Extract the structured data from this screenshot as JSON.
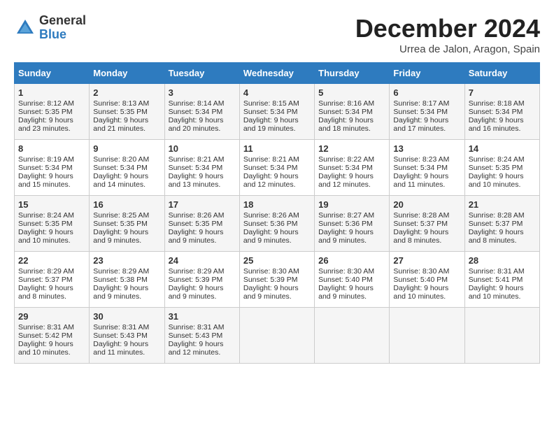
{
  "logo": {
    "general": "General",
    "blue": "Blue"
  },
  "title": "December 2024",
  "location": "Urrea de Jalon, Aragon, Spain",
  "days_of_week": [
    "Sunday",
    "Monday",
    "Tuesday",
    "Wednesday",
    "Thursday",
    "Friday",
    "Saturday"
  ],
  "weeks": [
    [
      {
        "day": "1",
        "sunrise": "Sunrise: 8:12 AM",
        "sunset": "Sunset: 5:35 PM",
        "daylight": "Daylight: 9 hours and 23 minutes."
      },
      {
        "day": "2",
        "sunrise": "Sunrise: 8:13 AM",
        "sunset": "Sunset: 5:35 PM",
        "daylight": "Daylight: 9 hours and 21 minutes."
      },
      {
        "day": "3",
        "sunrise": "Sunrise: 8:14 AM",
        "sunset": "Sunset: 5:34 PM",
        "daylight": "Daylight: 9 hours and 20 minutes."
      },
      {
        "day": "4",
        "sunrise": "Sunrise: 8:15 AM",
        "sunset": "Sunset: 5:34 PM",
        "daylight": "Daylight: 9 hours and 19 minutes."
      },
      {
        "day": "5",
        "sunrise": "Sunrise: 8:16 AM",
        "sunset": "Sunset: 5:34 PM",
        "daylight": "Daylight: 9 hours and 18 minutes."
      },
      {
        "day": "6",
        "sunrise": "Sunrise: 8:17 AM",
        "sunset": "Sunset: 5:34 PM",
        "daylight": "Daylight: 9 hours and 17 minutes."
      },
      {
        "day": "7",
        "sunrise": "Sunrise: 8:18 AM",
        "sunset": "Sunset: 5:34 PM",
        "daylight": "Daylight: 9 hours and 16 minutes."
      }
    ],
    [
      {
        "day": "8",
        "sunrise": "Sunrise: 8:19 AM",
        "sunset": "Sunset: 5:34 PM",
        "daylight": "Daylight: 9 hours and 15 minutes."
      },
      {
        "day": "9",
        "sunrise": "Sunrise: 8:20 AM",
        "sunset": "Sunset: 5:34 PM",
        "daylight": "Daylight: 9 hours and 14 minutes."
      },
      {
        "day": "10",
        "sunrise": "Sunrise: 8:21 AM",
        "sunset": "Sunset: 5:34 PM",
        "daylight": "Daylight: 9 hours and 13 minutes."
      },
      {
        "day": "11",
        "sunrise": "Sunrise: 8:21 AM",
        "sunset": "Sunset: 5:34 PM",
        "daylight": "Daylight: 9 hours and 12 minutes."
      },
      {
        "day": "12",
        "sunrise": "Sunrise: 8:22 AM",
        "sunset": "Sunset: 5:34 PM",
        "daylight": "Daylight: 9 hours and 12 minutes."
      },
      {
        "day": "13",
        "sunrise": "Sunrise: 8:23 AM",
        "sunset": "Sunset: 5:34 PM",
        "daylight": "Daylight: 9 hours and 11 minutes."
      },
      {
        "day": "14",
        "sunrise": "Sunrise: 8:24 AM",
        "sunset": "Sunset: 5:35 PM",
        "daylight": "Daylight: 9 hours and 10 minutes."
      }
    ],
    [
      {
        "day": "15",
        "sunrise": "Sunrise: 8:24 AM",
        "sunset": "Sunset: 5:35 PM",
        "daylight": "Daylight: 9 hours and 10 minutes."
      },
      {
        "day": "16",
        "sunrise": "Sunrise: 8:25 AM",
        "sunset": "Sunset: 5:35 PM",
        "daylight": "Daylight: 9 hours and 9 minutes."
      },
      {
        "day": "17",
        "sunrise": "Sunrise: 8:26 AM",
        "sunset": "Sunset: 5:35 PM",
        "daylight": "Daylight: 9 hours and 9 minutes."
      },
      {
        "day": "18",
        "sunrise": "Sunrise: 8:26 AM",
        "sunset": "Sunset: 5:36 PM",
        "daylight": "Daylight: 9 hours and 9 minutes."
      },
      {
        "day": "19",
        "sunrise": "Sunrise: 8:27 AM",
        "sunset": "Sunset: 5:36 PM",
        "daylight": "Daylight: 9 hours and 9 minutes."
      },
      {
        "day": "20",
        "sunrise": "Sunrise: 8:28 AM",
        "sunset": "Sunset: 5:37 PM",
        "daylight": "Daylight: 9 hours and 8 minutes."
      },
      {
        "day": "21",
        "sunrise": "Sunrise: 8:28 AM",
        "sunset": "Sunset: 5:37 PM",
        "daylight": "Daylight: 9 hours and 8 minutes."
      }
    ],
    [
      {
        "day": "22",
        "sunrise": "Sunrise: 8:29 AM",
        "sunset": "Sunset: 5:37 PM",
        "daylight": "Daylight: 9 hours and 8 minutes."
      },
      {
        "day": "23",
        "sunrise": "Sunrise: 8:29 AM",
        "sunset": "Sunset: 5:38 PM",
        "daylight": "Daylight: 9 hours and 9 minutes."
      },
      {
        "day": "24",
        "sunrise": "Sunrise: 8:29 AM",
        "sunset": "Sunset: 5:39 PM",
        "daylight": "Daylight: 9 hours and 9 minutes."
      },
      {
        "day": "25",
        "sunrise": "Sunrise: 8:30 AM",
        "sunset": "Sunset: 5:39 PM",
        "daylight": "Daylight: 9 hours and 9 minutes."
      },
      {
        "day": "26",
        "sunrise": "Sunrise: 8:30 AM",
        "sunset": "Sunset: 5:40 PM",
        "daylight": "Daylight: 9 hours and 9 minutes."
      },
      {
        "day": "27",
        "sunrise": "Sunrise: 8:30 AM",
        "sunset": "Sunset: 5:40 PM",
        "daylight": "Daylight: 9 hours and 10 minutes."
      },
      {
        "day": "28",
        "sunrise": "Sunrise: 8:31 AM",
        "sunset": "Sunset: 5:41 PM",
        "daylight": "Daylight: 9 hours and 10 minutes."
      }
    ],
    [
      {
        "day": "29",
        "sunrise": "Sunrise: 8:31 AM",
        "sunset": "Sunset: 5:42 PM",
        "daylight": "Daylight: 9 hours and 10 minutes."
      },
      {
        "day": "30",
        "sunrise": "Sunrise: 8:31 AM",
        "sunset": "Sunset: 5:43 PM",
        "daylight": "Daylight: 9 hours and 11 minutes."
      },
      {
        "day": "31",
        "sunrise": "Sunrise: 8:31 AM",
        "sunset": "Sunset: 5:43 PM",
        "daylight": "Daylight: 9 hours and 12 minutes."
      },
      null,
      null,
      null,
      null
    ]
  ]
}
